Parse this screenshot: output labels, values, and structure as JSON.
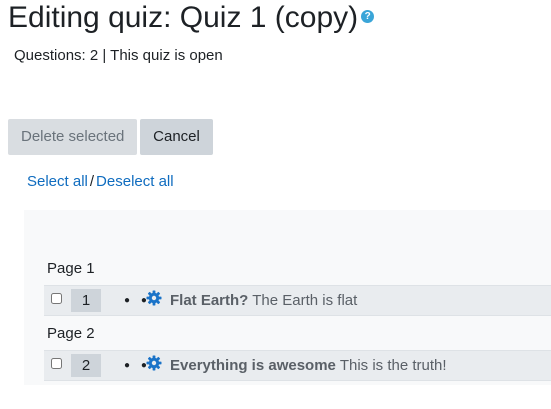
{
  "header": {
    "title": "Editing quiz: Quiz 1 (copy)",
    "help_icon": "question-circle-icon",
    "help_glyph": "?",
    "status": "Questions: 2 | This quiz is open"
  },
  "toolbar": {
    "delete_label": "Delete selected",
    "cancel_label": "Cancel"
  },
  "selection": {
    "select_all": "Select all",
    "separator": "/",
    "deselect_all": "Deselect all"
  },
  "pages": [
    {
      "label": "Page 1",
      "question": {
        "number": "1",
        "name": "Flat Earth?",
        "text": "The Earth is flat",
        "checked": false
      }
    },
    {
      "label": "Page 2",
      "question": {
        "number": "2",
        "name": "Everything is awesome",
        "text": "This is the truth!",
        "checked": false
      }
    }
  ],
  "icons": {
    "drag": "drag-dots-icon",
    "settings": "gear-icon",
    "dots_glyph": "● ●"
  },
  "colors": {
    "link": "#0f6cbf",
    "gear": "#1a73c8",
    "help": "#3aa5d8"
  }
}
